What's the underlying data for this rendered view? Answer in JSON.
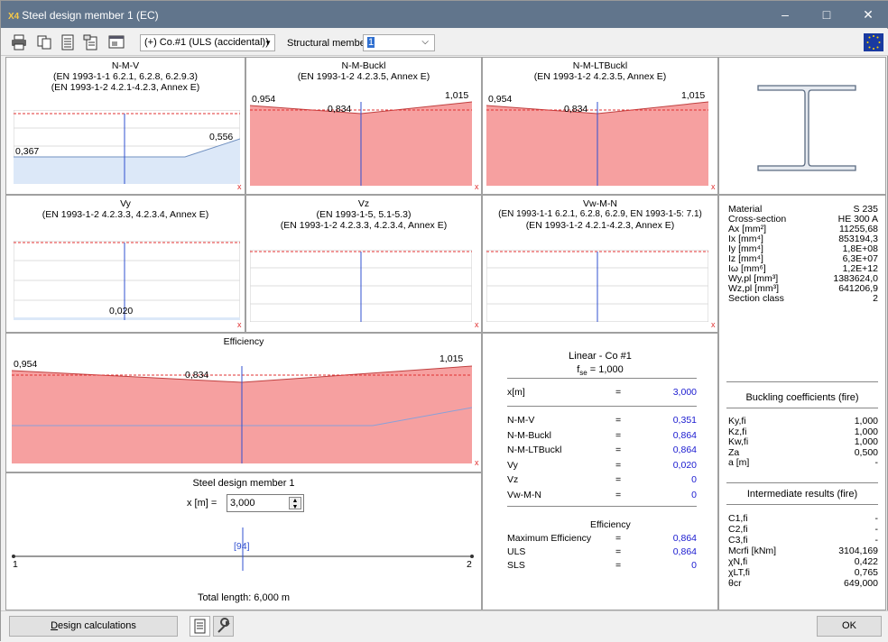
{
  "window": {
    "title": "Steel design member 1 (EC)",
    "app_badge": "X4"
  },
  "toolbar": {
    "combination": "(+) Co.#1 (ULS (accidental))",
    "member_label": "Structural member",
    "member_value": "1"
  },
  "panels": {
    "nmv": {
      "title": "N-M-V",
      "ref1": "(EN 1993-1-1 6.2.1, 6.2.8, 6.2.9.3)",
      "ref2": "(EN 1993-1-2 4.2.1-4.2.3, Annex E)",
      "left": "0,367",
      "right": "0,556"
    },
    "nmbuck": {
      "title": "N-M-Buckl",
      "ref1": "(EN 1993-1-2 4.2.3.5, Annex E)",
      "left": "0,954",
      "mid": "0,834",
      "right": "1,015"
    },
    "nmlt": {
      "title": "N-M-LTBuckl",
      "ref1": "(EN 1993-1-2 4.2.3.5, Annex E)",
      "left": "0,954",
      "mid": "0,834",
      "right": "1,015"
    },
    "vy": {
      "title": "Vy",
      "ref1": "(EN 1993-1-2 4.2.3.3, 4.2.3.4, Annex E)",
      "mid": "0,020"
    },
    "vz": {
      "title": "Vz",
      "ref1": "(EN 1993-1-5, 5.1-5.3)",
      "ref2": "(EN 1993-1-2 4.2.3.3, 4.2.3.4, Annex E)"
    },
    "vwmn": {
      "title": "Vw-M-N",
      "ref1": "(EN 1993-1-1 6.2.1, 6.2.8, 6.2.9, EN 1993-1-5: 7.1)",
      "ref2": "(EN 1993-1-2 4.2.1-4.2.3, Annex E)"
    },
    "eff": {
      "title": "Efficiency",
      "left": "0,954",
      "mid": "0,834",
      "right": "1,015"
    },
    "x_marker": "x"
  },
  "member": {
    "title": "Steel design member 1",
    "x_label": "x [m] =",
    "x_value": "3,000",
    "node_start": "1",
    "node_end": "2",
    "pos_label": "[94]",
    "total": "Total length: 6,000 m"
  },
  "results": {
    "header": "Linear - Co #1",
    "fse_label": "f",
    "fse_sub": "se",
    "fse_value": " = 1,000",
    "x_row": {
      "label": "x[m]",
      "eq": "=",
      "value": "3,000"
    },
    "rows": [
      {
        "label": "N-M-V",
        "eq": "=",
        "value": "0,351"
      },
      {
        "label": "N-M-Buckl",
        "eq": "=",
        "value": "0,864"
      },
      {
        "label": "N-M-LTBuckl",
        "eq": "=",
        "value": "0,864"
      },
      {
        "label": "Vy",
        "eq": "=",
        "value": "0,020"
      },
      {
        "label": "Vz",
        "eq": "=",
        "value": "0"
      },
      {
        "label": "Vw-M-N",
        "eq": "=",
        "value": "0"
      }
    ],
    "eff_header": "Efficiency",
    "eff_rows": [
      {
        "label": "Maximum Efficiency",
        "eq": "=",
        "value": "0,864"
      },
      {
        "label": "ULS",
        "eq": "=",
        "value": "0,864"
      },
      {
        "label": "SLS",
        "eq": "=",
        "value": "0"
      }
    ]
  },
  "props": [
    {
      "label": "Material",
      "value": "S 235"
    },
    {
      "label": "Cross-section",
      "value": "HE  300 A"
    },
    {
      "label": "Ax [mm²]",
      "value": "11255,68"
    },
    {
      "label": "Ix [mm⁴]",
      "value": "853194,3"
    },
    {
      "label": "Iy [mm⁴]",
      "value": "1,8E+08"
    },
    {
      "label": "Iz [mm⁴]",
      "value": "6,3E+07"
    },
    {
      "label": "Iω [mm⁶]",
      "value": "1,2E+12"
    },
    {
      "label": "Wy,pl [mm³]",
      "value": "1383624,0"
    },
    {
      "label": "Wz,pl [mm³]",
      "value": "641206,9"
    },
    {
      "label": "Section class",
      "value": "2"
    }
  ],
  "buckling": {
    "header": "Buckling coefficients (fire)",
    "rows": [
      {
        "label": "Ky,fi",
        "value": "1,000"
      },
      {
        "label": "Kz,fi",
        "value": "1,000"
      },
      {
        "label": "Kw,fi",
        "value": "1,000"
      },
      {
        "label": "Za",
        "value": "0,500"
      },
      {
        "label": "a [m]",
        "value": "-"
      }
    ]
  },
  "intermediate": {
    "header": "Intermediate results (fire)",
    "rows": [
      {
        "label": "C1,fi",
        "value": "-"
      },
      {
        "label": "C2,fi",
        "value": "-"
      },
      {
        "label": "C3,fi",
        "value": "-"
      },
      {
        "label": "Mcrfi [kNm]",
        "value": "3104,169"
      },
      {
        "label": "χN,fi",
        "value": "0,422"
      },
      {
        "label": "χLT,fi",
        "value": "0,765"
      },
      {
        "label": "θcr",
        "value": "649,000"
      }
    ]
  },
  "bottom": {
    "design_calc": "Design calculations",
    "ok": "OK"
  },
  "colors": {
    "fill_red": "#f6a0a0",
    "fill_blue": "#dce8f8",
    "line_red": "#e03030",
    "line_blue": "#3050d0",
    "title_bg": "#61758c"
  }
}
